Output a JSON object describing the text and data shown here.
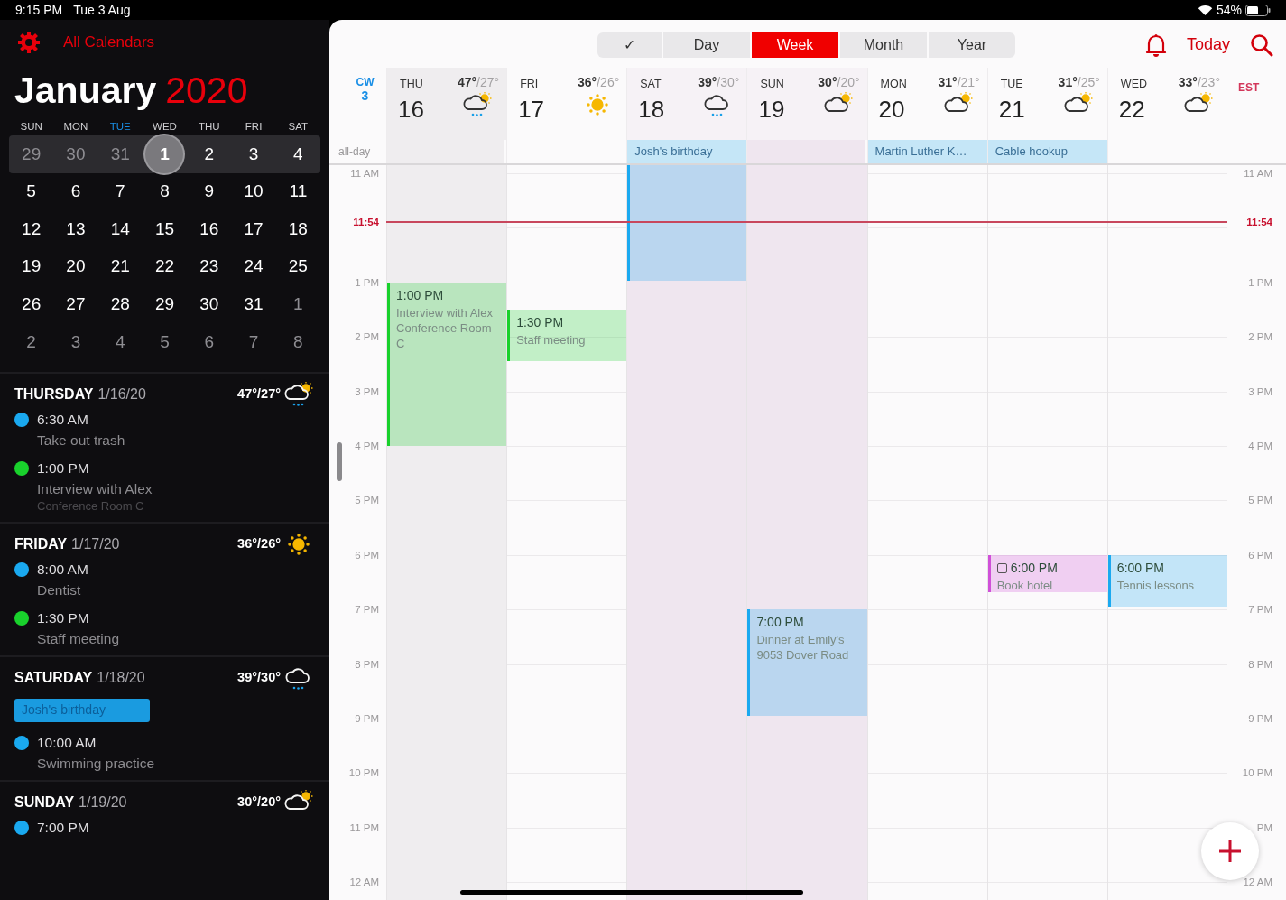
{
  "status_bar": {
    "time": "9:15 PM",
    "date": "Tue 3 Aug",
    "battery": "54%"
  },
  "sidebar": {
    "calendars_label": "All Calendars",
    "month": "January",
    "year": "2020",
    "weekdays": [
      {
        "label": "SUN",
        "today": false
      },
      {
        "label": "MON",
        "today": false
      },
      {
        "label": "TUE",
        "today": true
      },
      {
        "label": "WED",
        "today": false
      },
      {
        "label": "THU",
        "today": false
      },
      {
        "label": "FRI",
        "today": false
      },
      {
        "label": "SAT",
        "today": false
      }
    ],
    "weeks": [
      {
        "highlighted": true,
        "days": [
          {
            "label": "29",
            "muted": true,
            "selected": false
          },
          {
            "label": "30",
            "muted": true,
            "selected": false
          },
          {
            "label": "31",
            "muted": true,
            "selected": false
          },
          {
            "label": "1",
            "muted": false,
            "selected": true
          },
          {
            "label": "2",
            "muted": false,
            "selected": false
          },
          {
            "label": "3",
            "muted": false,
            "selected": false
          },
          {
            "label": "4",
            "muted": false,
            "selected": false
          }
        ]
      },
      {
        "highlighted": false,
        "days": [
          {
            "label": "5",
            "muted": false,
            "selected": false
          },
          {
            "label": "6",
            "muted": false,
            "selected": false
          },
          {
            "label": "7",
            "muted": false,
            "selected": false
          },
          {
            "label": "8",
            "muted": false,
            "selected": false
          },
          {
            "label": "9",
            "muted": false,
            "selected": false
          },
          {
            "label": "10",
            "muted": false,
            "selected": false
          },
          {
            "label": "11",
            "muted": false,
            "selected": false
          }
        ]
      },
      {
        "highlighted": false,
        "days": [
          {
            "label": "12",
            "muted": false,
            "selected": false
          },
          {
            "label": "13",
            "muted": false,
            "selected": false
          },
          {
            "label": "14",
            "muted": false,
            "selected": false
          },
          {
            "label": "15",
            "muted": false,
            "selected": false
          },
          {
            "label": "16",
            "muted": false,
            "selected": false
          },
          {
            "label": "17",
            "muted": false,
            "selected": false
          },
          {
            "label": "18",
            "muted": false,
            "selected": false
          }
        ]
      },
      {
        "highlighted": false,
        "days": [
          {
            "label": "19",
            "muted": false,
            "selected": false
          },
          {
            "label": "20",
            "muted": false,
            "selected": false
          },
          {
            "label": "21",
            "muted": false,
            "selected": false
          },
          {
            "label": "22",
            "muted": false,
            "selected": false
          },
          {
            "label": "23",
            "muted": false,
            "selected": false
          },
          {
            "label": "24",
            "muted": false,
            "selected": false
          },
          {
            "label": "25",
            "muted": false,
            "selected": false
          }
        ]
      },
      {
        "highlighted": false,
        "days": [
          {
            "label": "26",
            "muted": false,
            "selected": false
          },
          {
            "label": "27",
            "muted": false,
            "selected": false
          },
          {
            "label": "28",
            "muted": false,
            "selected": false
          },
          {
            "label": "29",
            "muted": false,
            "selected": false
          },
          {
            "label": "30",
            "muted": false,
            "selected": false
          },
          {
            "label": "31",
            "muted": false,
            "selected": false
          },
          {
            "label": "1",
            "muted": true,
            "selected": false
          }
        ]
      },
      {
        "highlighted": false,
        "days": [
          {
            "label": "2",
            "muted": true,
            "selected": false
          },
          {
            "label": "3",
            "muted": true,
            "selected": false
          },
          {
            "label": "4",
            "muted": true,
            "selected": false
          },
          {
            "label": "5",
            "muted": true,
            "selected": false
          },
          {
            "label": "6",
            "muted": true,
            "selected": false
          },
          {
            "label": "7",
            "muted": true,
            "selected": false
          },
          {
            "label": "8",
            "muted": true,
            "selected": false
          }
        ]
      }
    ],
    "agenda": [
      {
        "day": "THURSDAY",
        "date": "1/16/20",
        "temps": "47°/27°",
        "weather_icon": {
          "kind": "rain-sun"
        },
        "events": [
          {
            "kind": "timed",
            "time": "6:30 AM",
            "title": "Take out trash",
            "color": "#1aa9f0"
          },
          {
            "kind": "timed",
            "time": "1:00 PM",
            "title": "Interview with Alex",
            "location": "Conference Room C",
            "color": "#19d12c"
          }
        ]
      },
      {
        "day": "FRIDAY",
        "date": "1/17/20",
        "temps": "36°/26°",
        "weather_icon": {
          "kind": "sun"
        },
        "events": [
          {
            "kind": "timed",
            "time": "8:00 AM",
            "title": "Dentist",
            "color": "#1aa9f0"
          },
          {
            "kind": "timed",
            "time": "1:30 PM",
            "title": "Staff meeting",
            "color": "#19d12c"
          }
        ]
      },
      {
        "day": "SATURDAY",
        "date": "1/18/20",
        "temps": "39°/30°",
        "weather_icon": {
          "kind": "rain"
        },
        "events": [
          {
            "kind": "allday",
            "title": "Josh's birthday",
            "color": "#1a9be0"
          },
          {
            "kind": "timed",
            "time": "10:00 AM",
            "title": "Swimming practice",
            "color": "#1aa9f0"
          }
        ]
      },
      {
        "day": "SUNDAY",
        "date": "1/19/20",
        "temps": "30°/20°",
        "weather_icon": {
          "kind": "cloud-sun"
        },
        "events": [
          {
            "kind": "timed",
            "time": "7:00 PM",
            "color": "#1aa9f0"
          }
        ]
      }
    ]
  },
  "toolbar": {
    "segments": [
      {
        "label": "✓",
        "selected": false
      },
      {
        "label": "Day",
        "selected": false
      },
      {
        "label": "Week",
        "selected": true
      },
      {
        "label": "Month",
        "selected": false
      },
      {
        "label": "Year",
        "selected": false
      }
    ],
    "today": "Today"
  },
  "week": {
    "cw_label": "CW",
    "cw_number": "3",
    "timezone": "EST",
    "allday_label": "all-day",
    "days": [
      {
        "weekday": "THU",
        "number": "16",
        "high": "47°",
        "low": "/27°",
        "weather_icon": {
          "kind": "rain-sun"
        },
        "selected": true,
        "weekend": false,
        "events": [
          {
            "time": "1:00 PM",
            "title": "Interview with Alex",
            "location": "Conference Room C",
            "color": "#19d12c",
            "kind": "event"
          }
        ]
      },
      {
        "weekday": "FRI",
        "number": "17",
        "high": "36°",
        "low": "/26°",
        "weather_icon": {
          "kind": "sun"
        },
        "selected": false,
        "weekend": false,
        "events": [
          {
            "time": "1:30 PM",
            "title": "Staff meeting",
            "color": "#19d12c",
            "kind": "event"
          }
        ]
      },
      {
        "weekday": "SAT",
        "number": "18",
        "high": "39°",
        "low": "/30°",
        "weather_icon": {
          "kind": "rain"
        },
        "selected": false,
        "weekend": true,
        "allday": [
          {
            "title": "Josh's birthday",
            "color": "#c5e6f7"
          }
        ],
        "events": [
          {
            "color": "#1aa9f0",
            "kind": "event"
          }
        ]
      },
      {
        "weekday": "SUN",
        "number": "19",
        "high": "30°",
        "low": "/20°",
        "weather_icon": {
          "kind": "cloud-sun"
        },
        "selected": false,
        "weekend": true,
        "events": [
          {
            "time": "7:00 PM",
            "title": "Dinner at Emily's",
            "location": "9053 Dover Road",
            "color": "#1aa9f0",
            "kind": "event"
          }
        ]
      },
      {
        "weekday": "MON",
        "number": "20",
        "high": "31°",
        "low": "/21°",
        "weather_icon": {
          "kind": "cloud-sun"
        },
        "selected": false,
        "weekend": false,
        "allday": [
          {
            "title": "Martin Luther K…",
            "color": "#c5e6f7"
          }
        ]
      },
      {
        "weekday": "TUE",
        "number": "21",
        "high": "31°",
        "low": "/25°",
        "weather_icon": {
          "kind": "cloud-sun"
        },
        "selected": false,
        "weekend": false,
        "allday": [
          {
            "title": "Cable hookup",
            "color": "#c5e6f7"
          }
        ],
        "events": [
          {
            "time": "6:00 PM",
            "title": "Book hotel",
            "color": "#d050d8",
            "kind": "task"
          }
        ]
      },
      {
        "weekday": "WED",
        "number": "22",
        "high": "33°",
        "low": "/23°",
        "weather_icon": {
          "kind": "cloud-sun"
        },
        "selected": false,
        "weekend": false,
        "events": [
          {
            "time": "6:00 PM",
            "title": "Tennis lessons",
            "color": "#1aa9f0",
            "kind": "event"
          }
        ]
      }
    ],
    "left_times": [
      {
        "kind": "hour",
        "label": "11 AM"
      },
      {
        "kind": "now",
        "label": "11:54"
      },
      {
        "kind": "hour",
        "label": "1 PM"
      },
      {
        "kind": "hour",
        "label": "2 PM"
      },
      {
        "kind": "hour",
        "label": "3 PM"
      },
      {
        "kind": "hour",
        "label": "4 PM"
      },
      {
        "kind": "hour",
        "label": "5 PM"
      },
      {
        "kind": "hour",
        "label": "6 PM"
      },
      {
        "kind": "hour",
        "label": "7 PM"
      },
      {
        "kind": "hour",
        "label": "8 PM"
      },
      {
        "kind": "hour",
        "label": "9 PM"
      },
      {
        "kind": "hour",
        "label": "10 PM"
      },
      {
        "kind": "hour",
        "label": "11 PM"
      },
      {
        "kind": "hour",
        "label": "12 AM"
      }
    ],
    "right_times": [
      {
        "kind": "hour",
        "label": "11 AM"
      },
      {
        "kind": "now",
        "label": "11:54"
      },
      {
        "kind": "hour",
        "label": "1 PM"
      },
      {
        "kind": "hour",
        "label": "2 PM"
      },
      {
        "kind": "hour",
        "label": "3 PM"
      },
      {
        "kind": "hour",
        "label": "4 PM"
      },
      {
        "kind": "hour",
        "label": "5 PM"
      },
      {
        "kind": "hour",
        "label": "6 PM"
      },
      {
        "kind": "hour",
        "label": "7 PM"
      },
      {
        "kind": "hour",
        "label": "8 PM"
      },
      {
        "kind": "hour",
        "label": "9 PM"
      },
      {
        "kind": "hour",
        "label": "10 PM"
      },
      {
        "kind": "hour",
        "label": "PM"
      },
      {
        "kind": "hour",
        "label": "12 AM"
      }
    ]
  }
}
